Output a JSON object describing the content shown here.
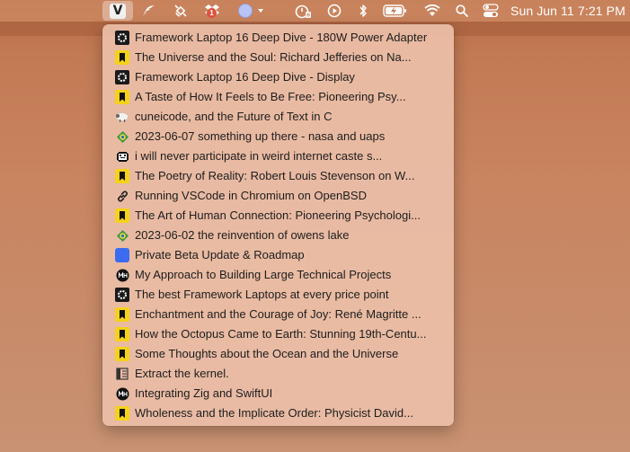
{
  "menubar": {
    "app_letter": "V",
    "dropbox_badge": "1",
    "date": "Sun Jun 11",
    "time": "7:21 PM",
    "icons": [
      "v-app-icon",
      "feather-icon",
      "satellite-icon",
      "dropbox-icon",
      "circle-dropdown-icon",
      "timer-pause-icon",
      "play-icon",
      "bluetooth-icon",
      "battery-icon",
      "wifi-icon",
      "search-icon",
      "control-center-icon"
    ]
  },
  "menu": {
    "items": [
      {
        "label": "Framework Laptop 16 Deep Dive - 180W Power Adapter",
        "icon": "framework-icon"
      },
      {
        "label": "The Universe and the Soul: Richard Jefferies on Na...",
        "icon": "marginalian-icon"
      },
      {
        "label": "Framework Laptop 16 Deep Dive - Display",
        "icon": "framework-icon"
      },
      {
        "label": "A Taste of How It Feels to Be Free: Pioneering Psy...",
        "icon": "marginalian-icon"
      },
      {
        "label": "cuneicode, and the Future of Text in C",
        "icon": "sheep-icon"
      },
      {
        "label": "2023-06-07 something up there - nasa and uaps",
        "icon": "globe-icon"
      },
      {
        "label": "i will never participate in weird internet caste s...",
        "icon": "pixel-face-icon"
      },
      {
        "label": "The Poetry of Reality: Robert Louis Stevenson on W...",
        "icon": "marginalian-icon"
      },
      {
        "label": "Running VSCode in Chromium on OpenBSD",
        "icon": "link-icon"
      },
      {
        "label": "The Art of Human Connection: Pioneering Psychologi...",
        "icon": "marginalian-icon"
      },
      {
        "label": "2023-06-02 the reinvention of owens lake",
        "icon": "globe-icon"
      },
      {
        "label": "Private Beta Update & Roadmap",
        "icon": "blue-square-icon"
      },
      {
        "label": "My Approach to Building Large Technical Projects",
        "icon": "mh-icon"
      },
      {
        "label": "The best Framework Laptops at every price point",
        "icon": "framework-icon"
      },
      {
        "label": "Enchantment and the Courage of Joy: René Magritte ...",
        "icon": "marginalian-icon"
      },
      {
        "label": "How the Octopus Came to Earth: Stunning 19th-Centu...",
        "icon": "marginalian-icon"
      },
      {
        "label": "Some Thoughts about the Ocean and the Universe",
        "icon": "marginalian-icon"
      },
      {
        "label": "Extract the kernel.",
        "icon": "columns-icon"
      },
      {
        "label": "Integrating Zig and SwiftUI",
        "icon": "mh-icon"
      },
      {
        "label": "Wholeness and the Implicate Order: Physicist David...",
        "icon": "marginalian-icon"
      }
    ]
  },
  "colors": {
    "menu_bg": "#ecbea8",
    "framework": "#1a1a1a",
    "marginalian": "#f4d21b",
    "blue": "#3b6cf0",
    "badge": "#e0533d"
  }
}
